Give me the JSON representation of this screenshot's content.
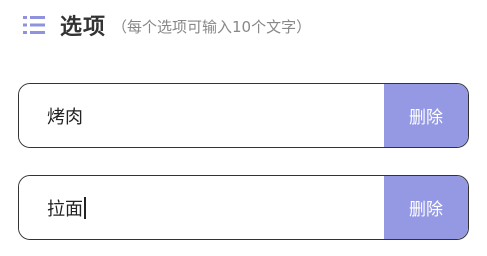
{
  "header": {
    "icon": "list-icon",
    "icon_color": "#8f93dd",
    "title": "选项",
    "subtitle": "（每个选项可输入10个文字）"
  },
  "options": [
    {
      "value": "烤肉",
      "delete_label": "删除"
    },
    {
      "value": "拉面",
      "delete_label": "删除",
      "focused": true
    }
  ],
  "colors": {
    "delete_button_bg": "#9599e3",
    "border": "#333333"
  }
}
